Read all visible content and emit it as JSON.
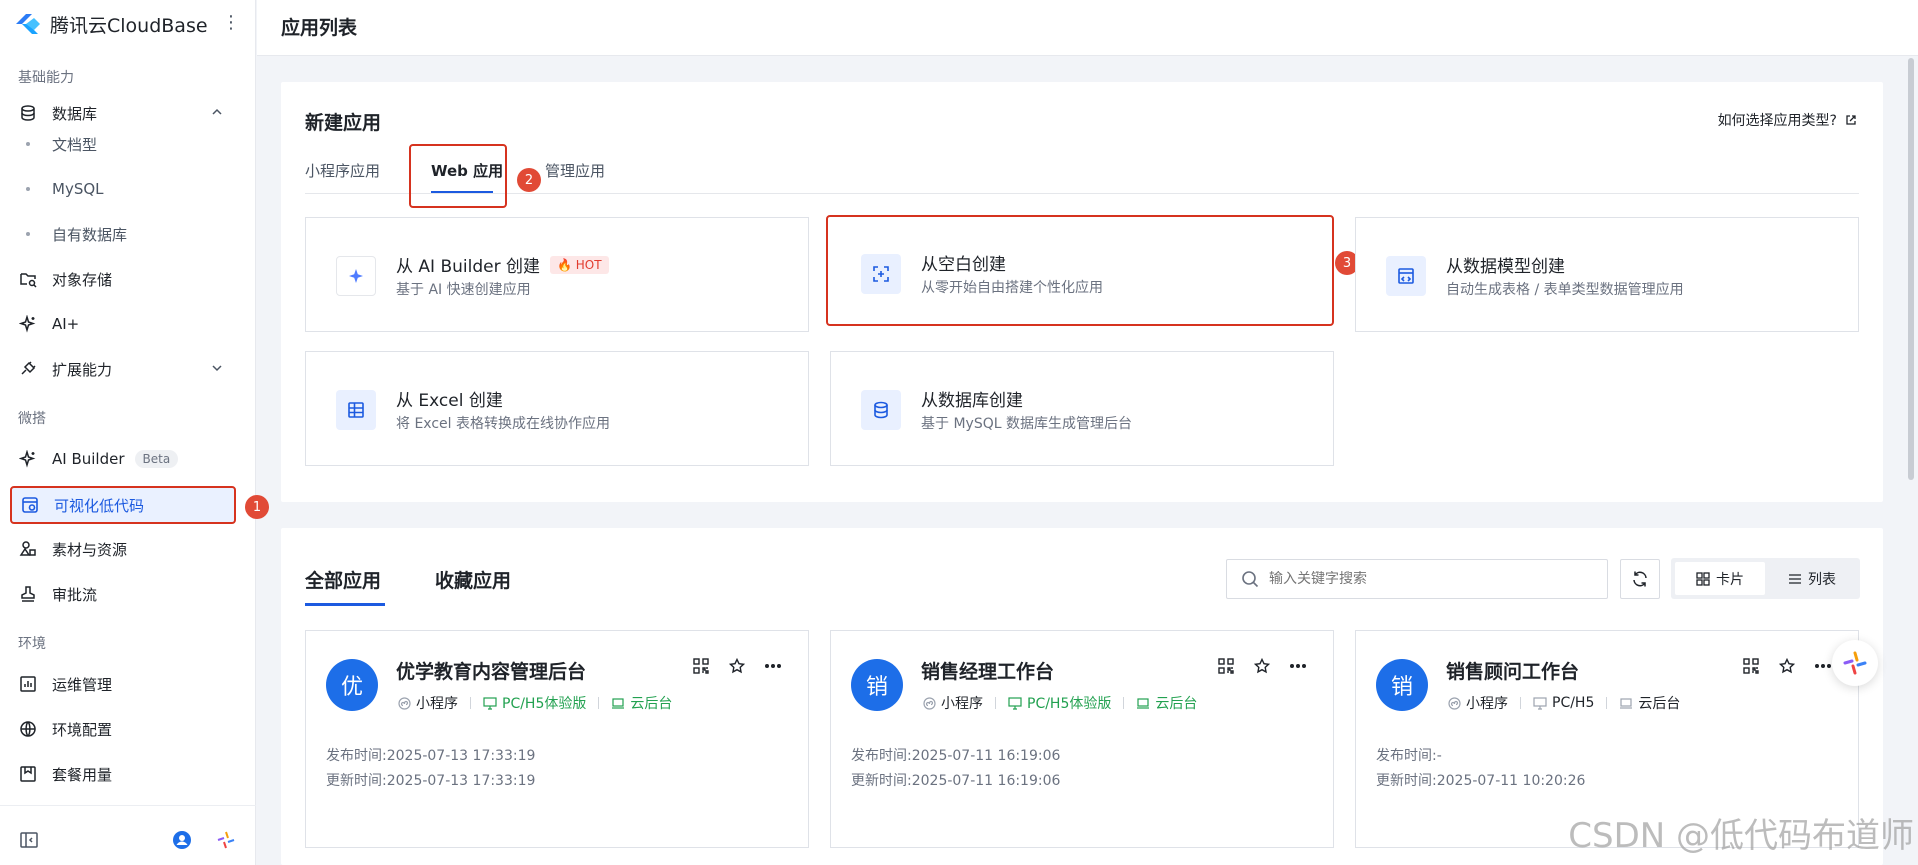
{
  "brand": {
    "name": "腾讯云CloudBase"
  },
  "sidebar": {
    "sections": {
      "basic": "基础能力",
      "micro": "微搭",
      "env": "环境"
    },
    "database": "数据库",
    "db_sub": [
      "文档型",
      "MySQL",
      "自有数据库"
    ],
    "storage": "对象存储",
    "ai_plus": "AI+",
    "extension": "扩展能力",
    "ai_builder": "AI Builder",
    "beta": "Beta",
    "lowcode": "可视化低代码",
    "assets": "素材与资源",
    "approval": "审批流",
    "ops": "运维管理",
    "envconfig": "环境配置",
    "usage": "套餐用量"
  },
  "markers": [
    "1",
    "2",
    "3"
  ],
  "header": {
    "title": "应用列表"
  },
  "new_app": {
    "title": "新建应用",
    "help": "如何选择应用类型?",
    "tabs": [
      "小程序应用",
      "Web 应用",
      "管理应用"
    ],
    "cards": [
      {
        "title": "从 AI Builder 创建",
        "badge": "HOT",
        "desc": "基于 AI 快速创建应用"
      },
      {
        "title": "从空白创建",
        "desc": "从零开始自由搭建个性化应用"
      },
      {
        "title": "从数据模型创建",
        "desc": "自动生成表格 / 表单类型数据管理应用"
      },
      {
        "title": "从 Excel 创建",
        "desc": "将 Excel 表格转换成在线协作应用"
      },
      {
        "title": "从数据库创建",
        "desc": "基于 MySQL 数据库生成管理后台"
      }
    ]
  },
  "list": {
    "tabs": [
      "全部应用",
      "收藏应用"
    ],
    "search_placeholder": "输入关键字搜索",
    "view_card": "卡片",
    "view_list": "列表",
    "published_label": "发布时间:",
    "updated_label": "更新时间:",
    "apps": [
      {
        "avatar": "优",
        "name": "优学教育内容管理后台",
        "p1": "小程序",
        "p2": "PC/H5体验版",
        "p3": "云后台",
        "published": "2025-07-13 17:33:19",
        "updated": "2025-07-13 17:33:19"
      },
      {
        "avatar": "销",
        "name": "销售经理工作台",
        "p1": "小程序",
        "p2": "PC/H5体验版",
        "p3": "云后台",
        "published": "2025-07-11 16:19:06",
        "updated": "2025-07-11 16:19:06"
      },
      {
        "avatar": "销",
        "name": "销售顾问工作台",
        "p1": "小程序",
        "p2": "PC/H5",
        "p3": "云后台",
        "published": "-",
        "updated": "2025-07-11 10:20:26"
      }
    ]
  },
  "watermark": "CSDN @低代码布道师"
}
